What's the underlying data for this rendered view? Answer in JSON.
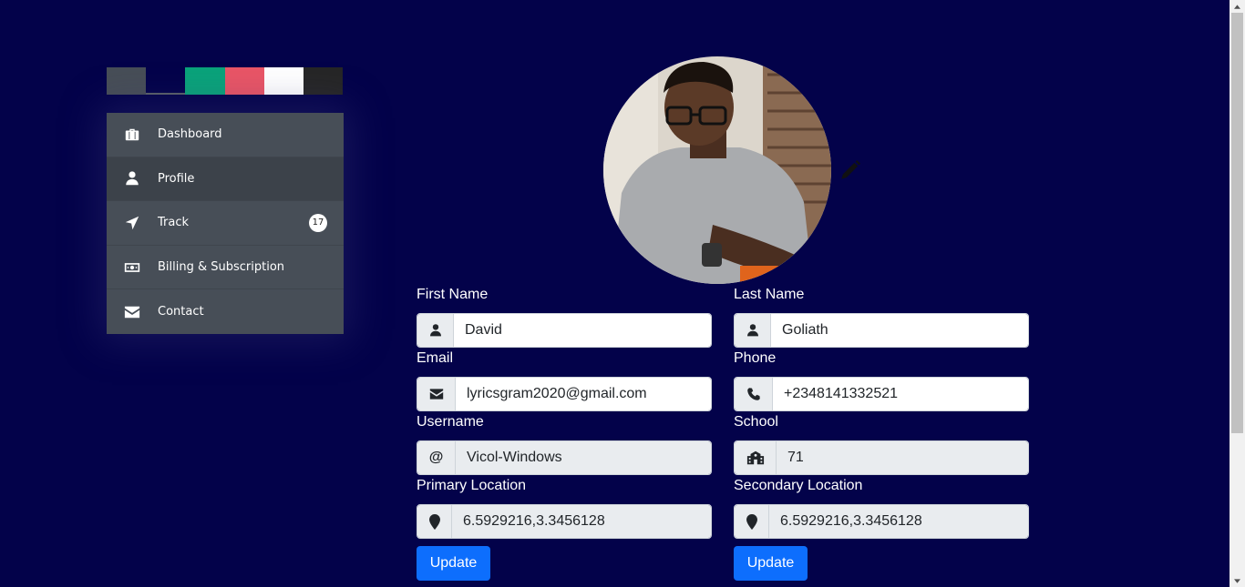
{
  "theme_swatches": [
    {
      "name": "slate",
      "color": "#474e57"
    },
    {
      "name": "navy",
      "color": "#03024a",
      "active": true
    },
    {
      "name": "green",
      "color": "#0aa37a"
    },
    {
      "name": "red",
      "color": "#e95566"
    },
    {
      "name": "white",
      "color": "#ffffff"
    },
    {
      "name": "dark",
      "color": "#262626"
    }
  ],
  "sidebar": {
    "items": [
      {
        "label": "Dashboard",
        "icon": "briefcase-icon"
      },
      {
        "label": "Profile",
        "icon": "user-icon",
        "active": true
      },
      {
        "label": "Track",
        "icon": "location-arrow-icon",
        "badge": "17"
      },
      {
        "label": "Billing & Subscription",
        "icon": "money-bill-icon"
      },
      {
        "label": "Contact",
        "icon": "envelope-icon"
      }
    ]
  },
  "profile": {
    "first_name": {
      "label": "First Name",
      "value": "David",
      "icon": "user-icon"
    },
    "last_name": {
      "label": "Last Name",
      "value": "Goliath",
      "icon": "user-icon"
    },
    "email": {
      "label": "Email",
      "value": "lyricsgram2020@gmail.com",
      "icon": "envelope-icon"
    },
    "phone": {
      "label": "Phone",
      "value": "+2348141332521",
      "icon": "phone-icon"
    },
    "username": {
      "label": "Username",
      "value": "Vicol-Windows",
      "icon": "at-icon"
    },
    "school": {
      "label": "School",
      "value": "71",
      "icon": "school-icon"
    },
    "primary_location": {
      "label": "Primary Location",
      "value": "6.5929216,3.3456128",
      "icon": "map-marker-icon"
    },
    "secondary_location": {
      "label": "Secondary Location",
      "value": "6.5929216,3.3456128",
      "icon": "map-marker-icon"
    },
    "update_left_label": "Update",
    "update_right_label": "Update"
  },
  "colors": {
    "background": "#03024a",
    "sidebar": "#474e57",
    "primary_button": "#0d6efd"
  }
}
